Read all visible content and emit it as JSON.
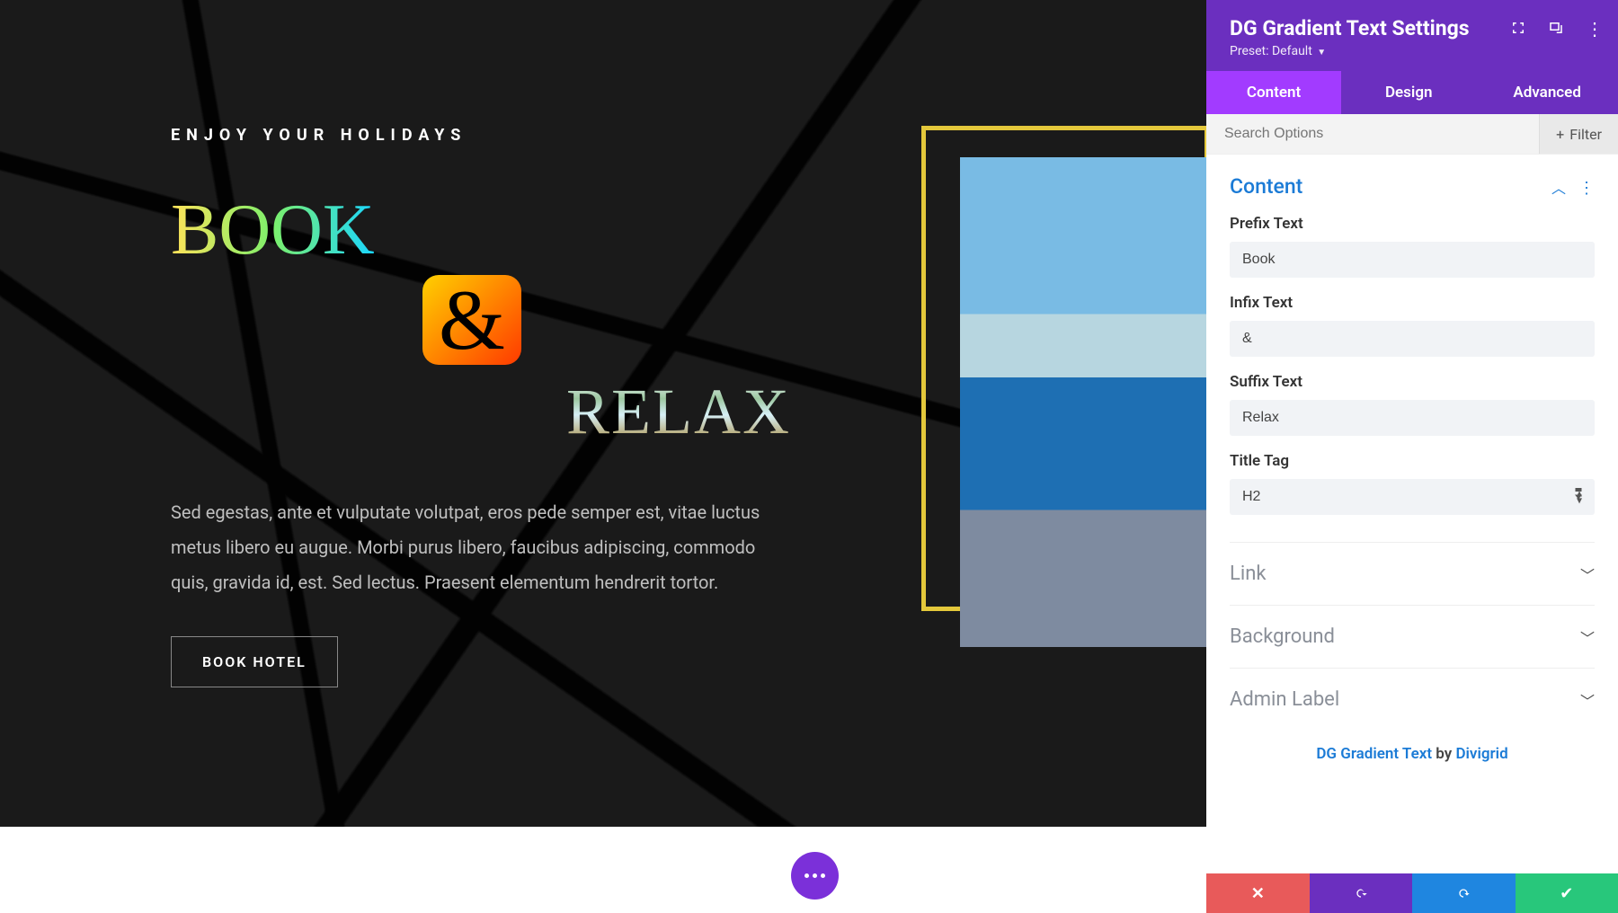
{
  "preview": {
    "kicker": "ENJOY YOUR HOLIDAYS",
    "prefix_word": "BOOK",
    "infix_word": "&",
    "suffix_word": "RELAX",
    "body": "Sed egestas, ante et vulputate volutpat, eros pede semper est, vitae luctus metus libero eu augue. Morbi purus libero, faucibus adipiscing, commodo quis, gravida id, est. Sed lectus. Praesent elementum hendrerit tortor.",
    "cta": "BOOK HOTEL"
  },
  "panel": {
    "title": "DG Gradient Text Settings",
    "preset_label": "Preset:",
    "preset_value": "Default",
    "tabs": {
      "content": "Content",
      "design": "Design",
      "advanced": "Advanced"
    },
    "search_placeholder": "Search Options",
    "filter_label": "Filter",
    "sections": {
      "content_title": "Content",
      "fields": {
        "prefix_label": "Prefix Text",
        "prefix_value": "Book",
        "infix_label": "Infix Text",
        "infix_value": "&",
        "suffix_label": "Suffix Text",
        "suffix_value": "Relax",
        "title_tag_label": "Title Tag",
        "title_tag_value": "H2"
      },
      "collapsed": {
        "link": "Link",
        "background": "Background",
        "admin_label": "Admin Label"
      }
    },
    "credit": {
      "text1": "DG Gradient Text",
      "by": " by ",
      "text2": "Divigrid"
    }
  }
}
